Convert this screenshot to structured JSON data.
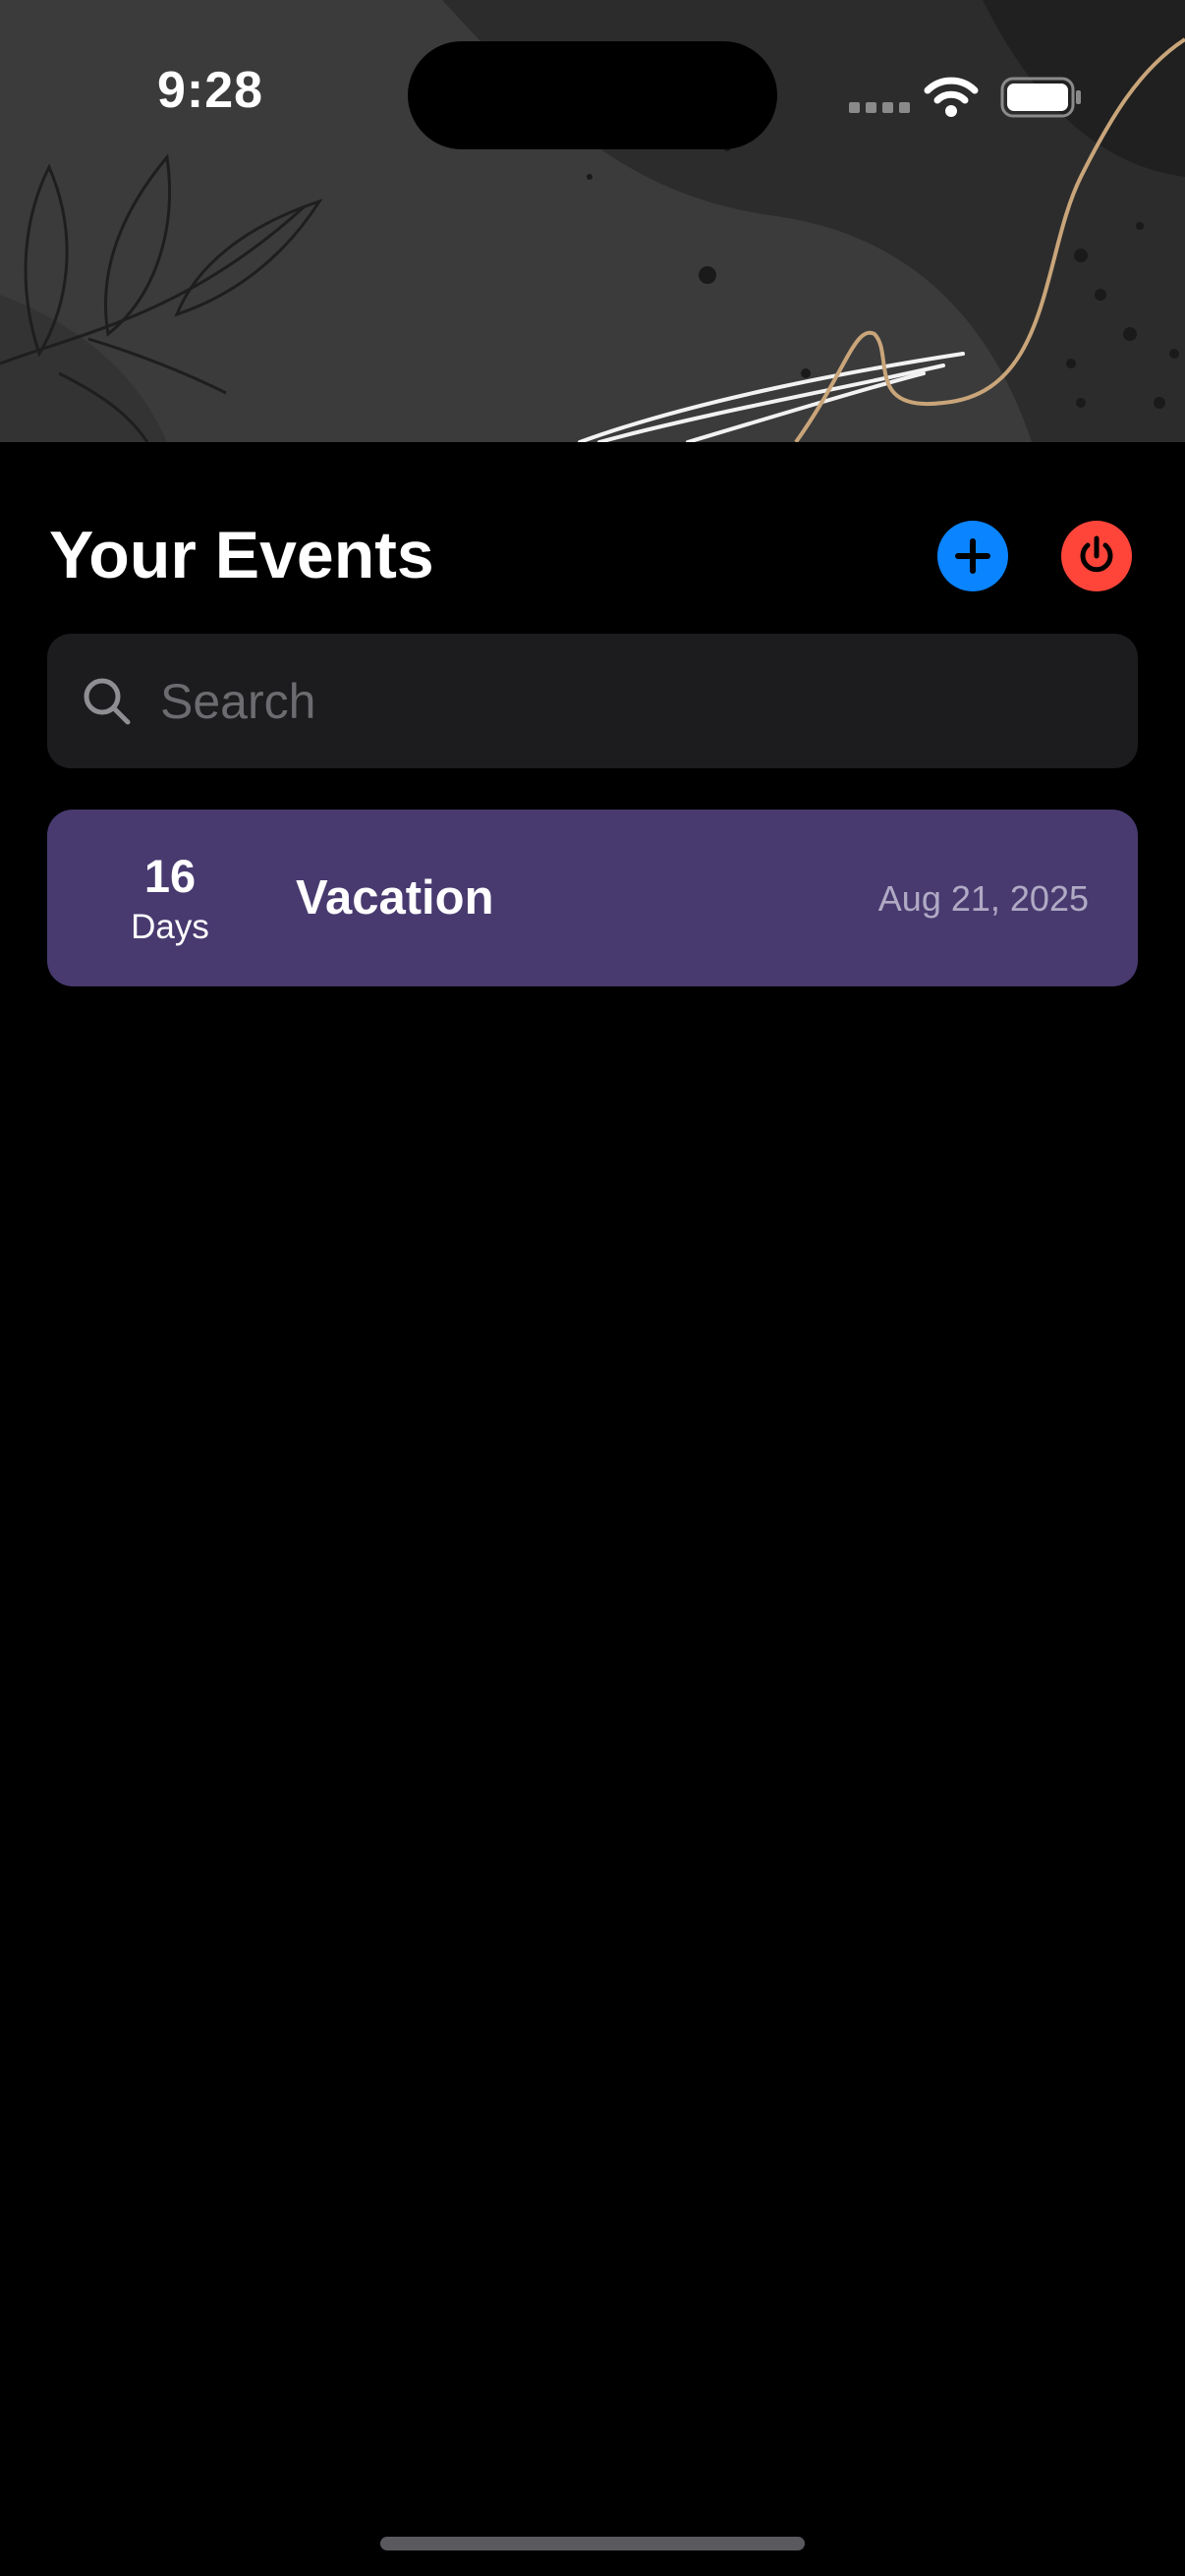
{
  "status_bar": {
    "time": "9:28",
    "icons": [
      "cellular-signal-icon",
      "wifi-icon",
      "battery-icon"
    ]
  },
  "header": {
    "title": "Your Events",
    "add_icon": "plus-icon",
    "power_icon": "power-icon"
  },
  "search": {
    "placeholder": "Search",
    "value": "",
    "icon": "magnifying-glass-icon"
  },
  "events": [
    {
      "days_count": "16",
      "days_label": "Days",
      "name": "Vacation",
      "date": "Aug 21, 2025"
    }
  ],
  "colors": {
    "background": "#000000",
    "add_button": "#0a84ff",
    "power_button": "#ff453a",
    "search_bg": "#1c1c1e",
    "event_card": "#483a6f",
    "event_date_text": "#b0aac4"
  }
}
